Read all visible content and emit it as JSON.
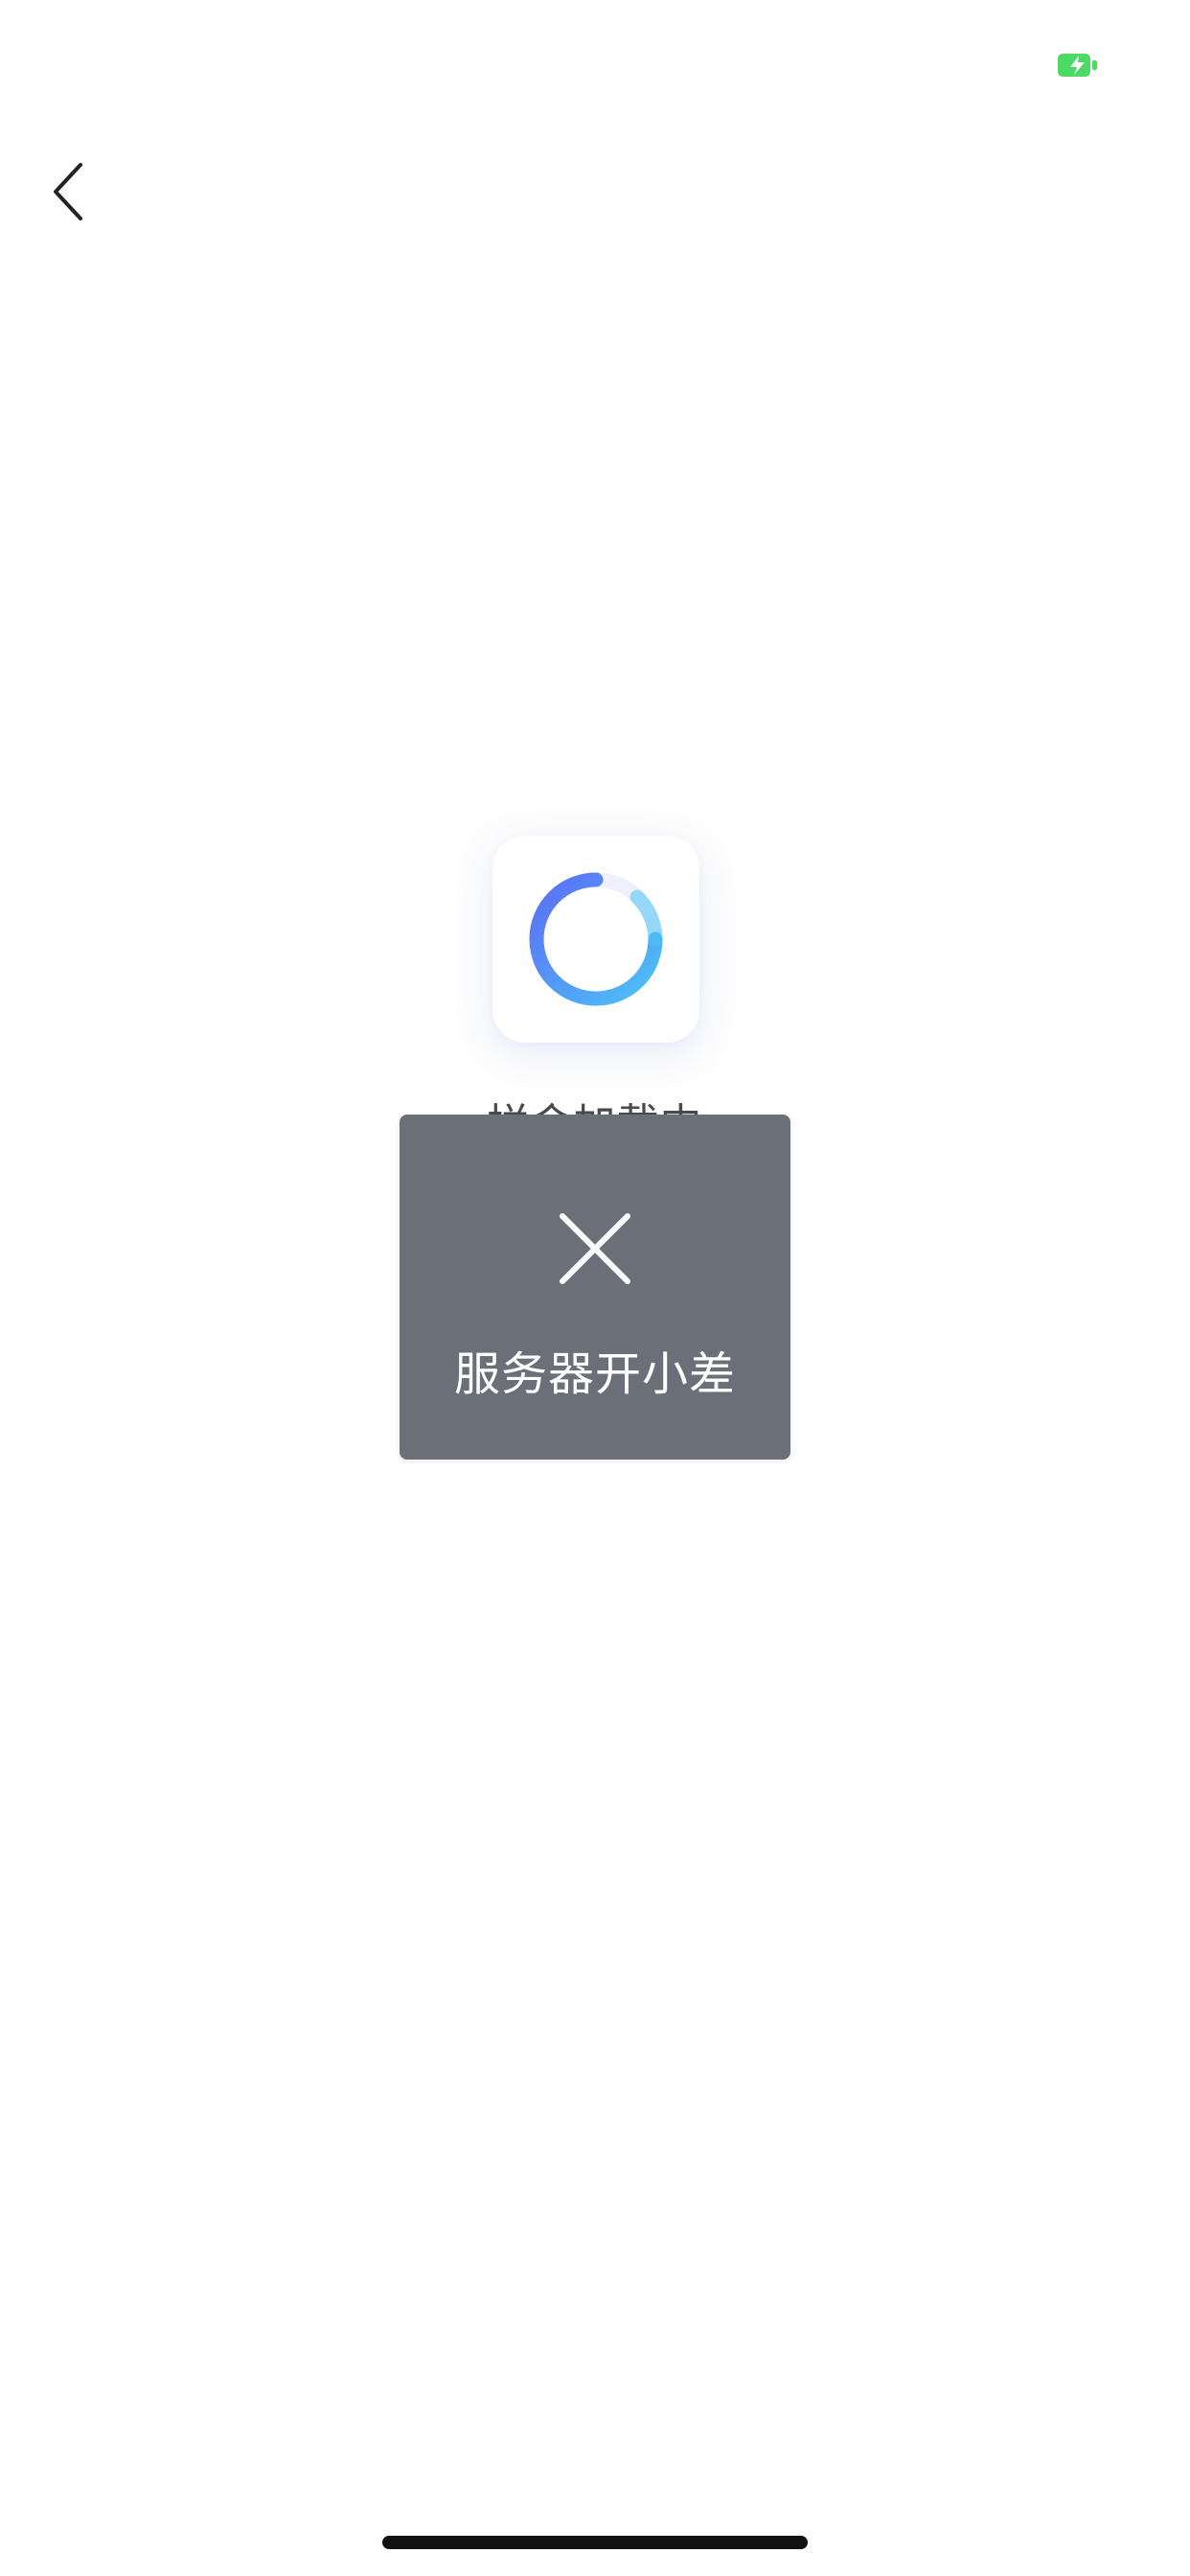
{
  "status_bar": {
    "battery_icon": "battery-charging-icon",
    "battery_color": "#4cd964"
  },
  "nav": {
    "back_icon": "chevron-left-icon"
  },
  "loading": {
    "spinner_icon": "loading-spinner-icon",
    "text": "拼命加载中",
    "spinner_colors": [
      "#5b6ef5",
      "#4cc3f7"
    ]
  },
  "toast": {
    "icon": "close-icon",
    "message": "服务器开小差",
    "background": "#6b6f78"
  },
  "home_indicator": {
    "icon": "home-indicator-bar"
  }
}
